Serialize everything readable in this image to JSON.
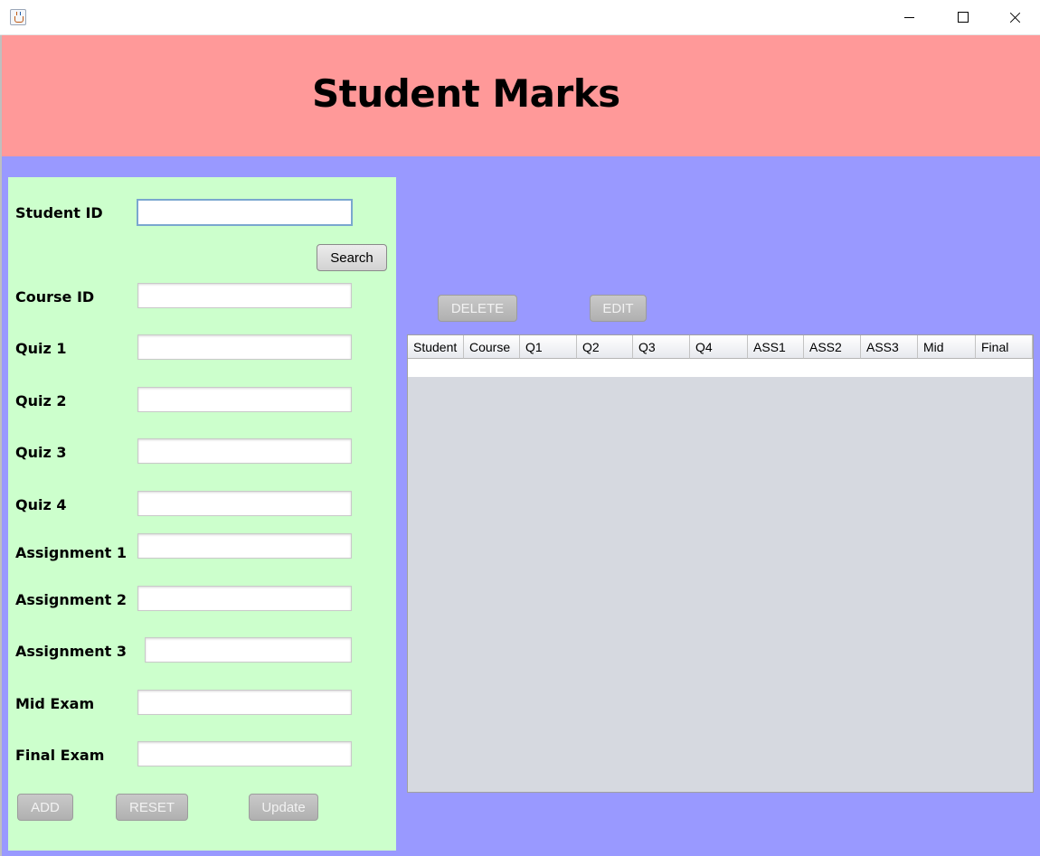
{
  "header": {
    "title": "Student Marks"
  },
  "form": {
    "student_id_label": "Student ID",
    "search_label": "Search",
    "fields": [
      {
        "label": "Course ID",
        "value": ""
      },
      {
        "label": "Quiz 1",
        "value": ""
      },
      {
        "label": "Quiz 2",
        "value": ""
      },
      {
        "label": "Quiz 3",
        "value": ""
      },
      {
        "label": "Quiz 4",
        "value": ""
      },
      {
        "label": "Assignment 1",
        "value": ""
      },
      {
        "label": "Assignment 2",
        "value": ""
      },
      {
        "label": "Assignment 3",
        "value": ""
      },
      {
        "label": "Mid Exam",
        "value": ""
      },
      {
        "label": "Final Exam",
        "value": ""
      }
    ],
    "add_label": "ADD",
    "reset_label": "RESET",
    "update_label": "Update"
  },
  "actions": {
    "delete_label": "DELETE",
    "edit_label": "EDIT"
  },
  "table": {
    "columns": [
      "Student",
      "Course",
      "Q1",
      "Q2",
      "Q3",
      "Q4",
      "ASS1",
      "ASS2",
      "ASS3",
      "Mid",
      "Final"
    ],
    "rows": []
  },
  "colors": {
    "header_bg": "#ff9999",
    "body_bg": "#9999ff",
    "form_bg": "#ccffcc",
    "table_bg": "#d6d9e0"
  }
}
